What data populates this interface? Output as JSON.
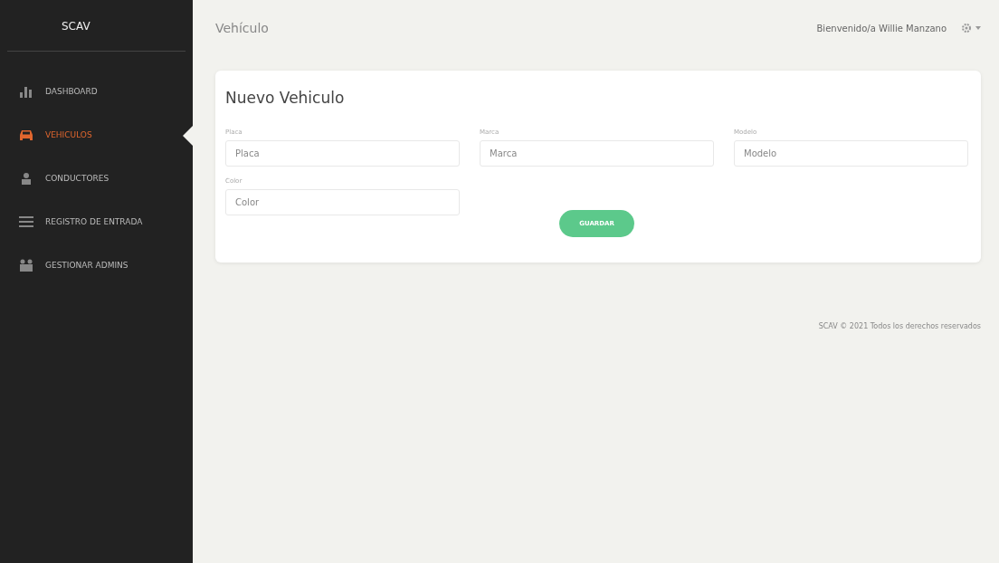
{
  "sidebar": {
    "brand": "SCAV",
    "items": [
      {
        "label": "DASHBOARD",
        "kind": "chart",
        "selected": false
      },
      {
        "label": "VEHICULOS",
        "kind": "car",
        "selected": true
      },
      {
        "label": "CONDUCTORES",
        "kind": "person",
        "selected": false
      },
      {
        "label": "REGISTRO DE ENTRADA",
        "kind": "list",
        "selected": false
      },
      {
        "label": "GESTIONAR ADMINS",
        "kind": "group",
        "selected": false
      }
    ]
  },
  "topbar": {
    "title": "Vehículo",
    "welcome": "Bienvenido/a Willie Manzano"
  },
  "form": {
    "title": "Nuevo Vehiculo",
    "fields": [
      {
        "label": "Placa",
        "placeholder": "Placa"
      },
      {
        "label": "Marca",
        "placeholder": "Marca"
      },
      {
        "label": "Modelo",
        "placeholder": "Modelo"
      },
      {
        "label": "Color",
        "placeholder": "Color"
      }
    ],
    "submit": "GUARDAR"
  },
  "footer": "SCAV © 2021 Todos los derechos reservados"
}
